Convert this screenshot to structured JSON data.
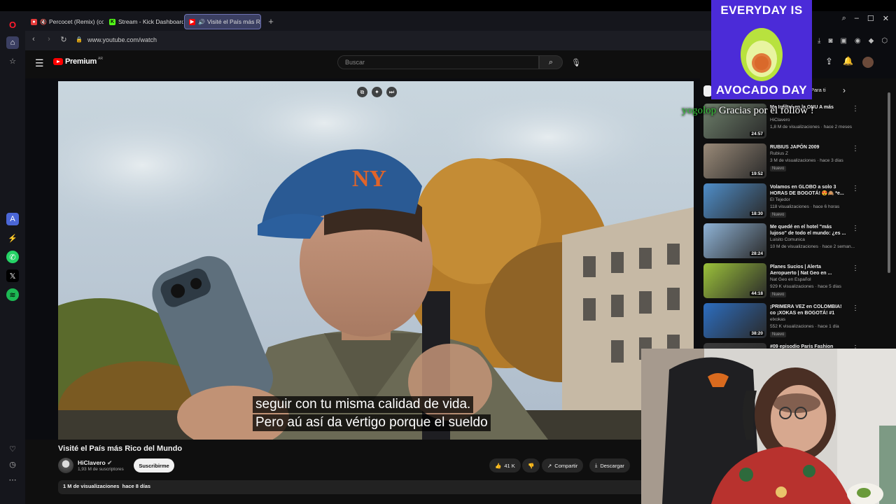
{
  "browser": {
    "tabs": [
      {
        "label": "Percocet (Remix) (con",
        "favicon_color": "#e23a3a",
        "muted": true
      },
      {
        "label": "Stream - Kick Dashboard",
        "favicon_color": "#53fc18"
      },
      {
        "label": "Visité el País más Rico",
        "favicon_color": "#ff0000",
        "active": true,
        "audio": true
      }
    ],
    "url": "www.youtube.com/watch",
    "sidebar_icons": [
      "opera-icon",
      "home-icon",
      "star-icon",
      "app-icon",
      "messenger-icon",
      "whatsapp-icon",
      "x-icon",
      "spotify-icon",
      "heart-icon",
      "history-icon",
      "more-icon"
    ]
  },
  "youtube": {
    "logo_text": "Premium",
    "logo_region": "AR",
    "search_placeholder": "Buscar",
    "video": {
      "subtitle_line1": "seguir con tu misma calidad de vida.",
      "subtitle_line2": "Pero aú así da vértigo porque el sueldo",
      "title": "Visité el País más Rico del Mundo",
      "channel": "HiClavero",
      "subscribers": "1,93 M de suscriptores",
      "subscribe_label": "Suscribirme",
      "likes": "41 K",
      "share_label": "Compartir",
      "download_label": "Descargar",
      "views": "1 M de visualizaciones",
      "age": "hace 8 días"
    },
    "filter_chip": "Para ti",
    "recommendations": [
      {
        "title": "Me Infiltré en la ONU A más",
        "channel": "HiClavero",
        "meta": "1,8 M de visualizaciones · hace 2 meses",
        "duration": "24:57",
        "new": false
      },
      {
        "title": "RUBIUS JAPÓN 2009",
        "channel": "Rubius Z",
        "meta": "3 M de visualizaciones · hace 3 días",
        "duration": "19:52",
        "new": true
      },
      {
        "title": "Volamos en GLOBO a solo 3 HORAS DE BOGOTÁ! 😍🙈 *e...",
        "channel": "El Tejedor",
        "meta": "118 visualizaciones · hace 6 horas",
        "duration": "18:30",
        "new": true
      },
      {
        "title": "Me quedé en el hotel \"más lujoso\" de todo el mundo: ¿es ...",
        "channel": "Luisito Comunica",
        "meta": "10 M de visualizaciones · hace 2 seman...",
        "duration": "28:24",
        "new": false
      },
      {
        "title": "Planes Sucios | Alerta Aeropuerto | Nat Geo en ...",
        "channel": "Nat Geo en Español",
        "meta": "929 K visualizaciones · hace 5 días",
        "duration": "44:18",
        "new": true
      },
      {
        "title": "¡PRIMERA VEZ en COLOMBIA! co ¡XOKAS en BOGOTÁ! #1",
        "channel": "elxokas",
        "meta": "552 K visualizaciones · hace 1 día",
        "duration": "38:20",
        "new": true
      },
      {
        "title": "#09 episodio Paris Fashion",
        "channel": "",
        "meta": "",
        "duration": "",
        "new": false
      }
    ]
  },
  "overlays": {
    "avocado_top": "EVERYDAY IS",
    "avocado_bottom": "AVOCADO DAY",
    "chat_user": "yogolop",
    "chat_message": "Gracias por el follow !"
  },
  "colors": {
    "accent": "#ff0000",
    "browser_bg": "#15161c",
    "yt_bg": "#0f0f0f",
    "avocado_bg": "#4b2bd8"
  }
}
